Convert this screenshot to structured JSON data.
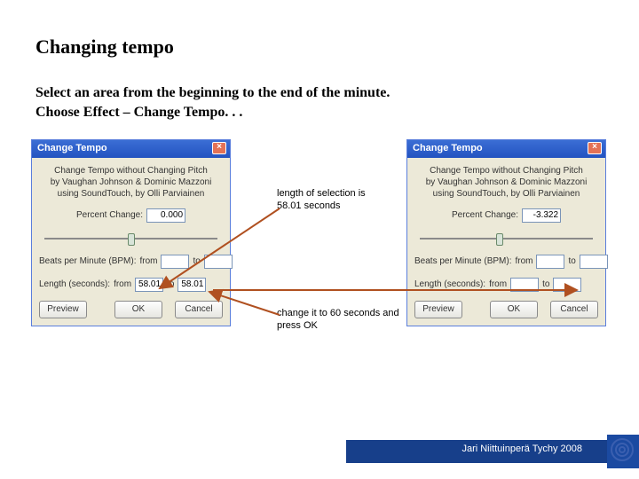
{
  "title": "Changing tempo",
  "subtitle_line1": "Select an area from the beginning to the end of the minute.",
  "subtitle_line2": "Choose Effect – Change Tempo. . .",
  "dialog": {
    "title": "Change Tempo",
    "close_glyph": "×",
    "heading_line1": "Change Tempo without Changing Pitch",
    "heading_line2": "by Vaughan Johnson & Dominic Mazzoni",
    "heading_line3": "using SoundTouch, by Olli Parviainen",
    "percent_label": "Percent Change:",
    "bpm_label": "Beats per Minute (BPM):",
    "length_label": "Length (seconds):",
    "from_label": "from",
    "to_label": "to",
    "preview_label": "Preview",
    "ok_label": "OK",
    "cancel_label": "Cancel"
  },
  "left_values": {
    "percent": "0.000",
    "bpm_from": "",
    "bpm_to": "",
    "len_from": "58.01",
    "len_to": "58.01"
  },
  "right_values": {
    "percent": "-3.322",
    "bpm_from": "",
    "bpm_to": "",
    "len_from": "",
    "len_to": ""
  },
  "annotations": {
    "a1": "length of selection is 58.01 seconds",
    "a2": "change it to 60 seconds and press OK"
  },
  "footer": {
    "credit": "Jari Niittuinperä Tychy 2008"
  }
}
